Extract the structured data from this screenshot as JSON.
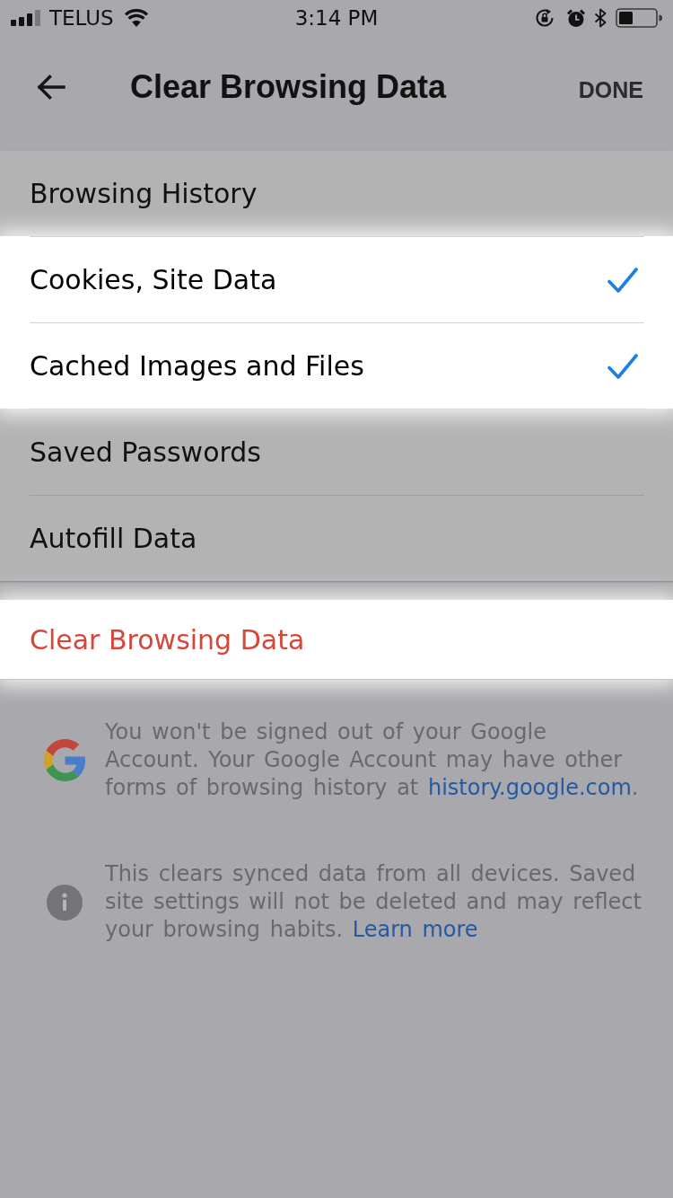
{
  "status_bar": {
    "carrier": "TELUS",
    "time": "3:14 PM"
  },
  "nav_bar": {
    "title": "Clear Browsing Data",
    "action": "DONE"
  },
  "options": [
    {
      "label": "Browsing History",
      "checked": false,
      "highlighted": false
    },
    {
      "label": "Cookies, Site Data",
      "checked": true,
      "highlighted": true
    },
    {
      "label": "Cached Images and Files",
      "checked": true,
      "highlighted": true
    },
    {
      "label": "Saved Passwords",
      "checked": false,
      "highlighted": false
    },
    {
      "label": "Autofill Data",
      "checked": false,
      "highlighted": false
    }
  ],
  "clear_button": {
    "label": "Clear Browsing Data",
    "highlighted": true
  },
  "notes": [
    {
      "kind": "google",
      "text": "You won't be signed out of your Google Account. Your Google Account may have other forms of browsing history at",
      "link": "history.google.com",
      "suffix": "."
    },
    {
      "kind": "info",
      "text": "This clears synced data from all devices. Saved site settings will not be deleted and may reflect your browsing habits.",
      "link": "Learn more"
    }
  ]
}
